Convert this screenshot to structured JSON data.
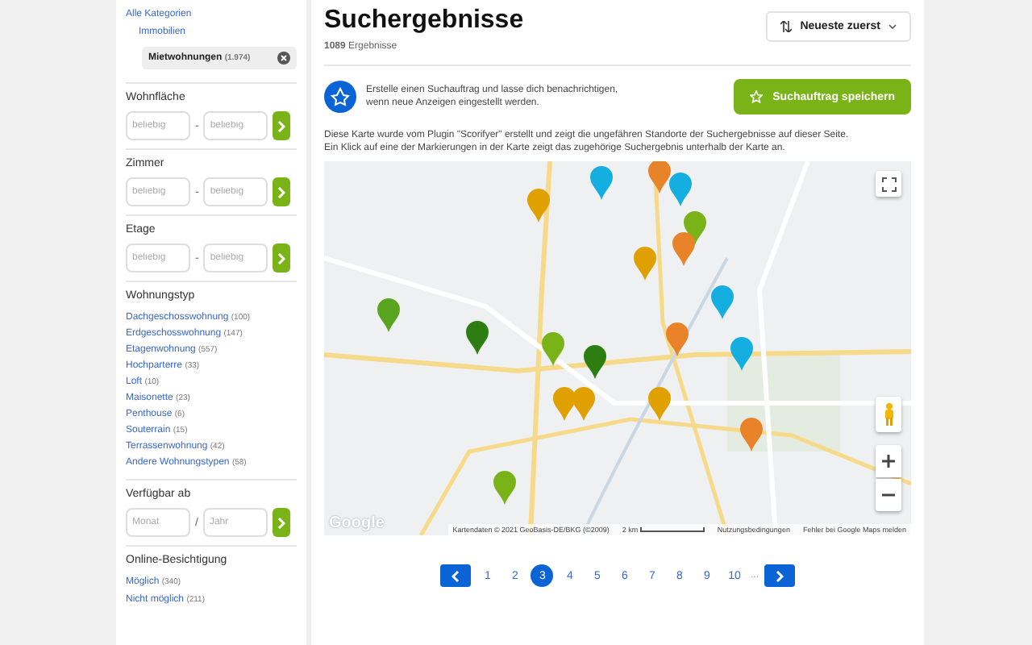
{
  "sidebar": {
    "categories": [
      {
        "label": "Alle Kategorien",
        "kind": "link"
      },
      {
        "label": "Immobilien",
        "kind": "link"
      },
      {
        "label": "Mietwohnungen",
        "count": "(1.974)",
        "kind": "chip"
      }
    ],
    "ranges": [
      {
        "title": "Wohnfläche",
        "from_placeholder": "beliebig",
        "to_placeholder": "beliebig",
        "separator": "-"
      },
      {
        "title": "Zimmer",
        "from_placeholder": "beliebig",
        "to_placeholder": "beliebig",
        "separator": "-"
      },
      {
        "title": "Etage",
        "from_placeholder": "beliebig",
        "to_placeholder": "beliebig",
        "separator": "-"
      }
    ],
    "types": {
      "title": "Wohnungstyp",
      "items": [
        {
          "label": "Dachgeschosswohnung",
          "count": "(100)"
        },
        {
          "label": "Erdgeschosswohnung",
          "count": "(147)"
        },
        {
          "label": "Etagenwohnung",
          "count": "(557)"
        },
        {
          "label": "Hochparterre",
          "count": "(33)"
        },
        {
          "label": "Loft",
          "count": "(10)"
        },
        {
          "label": "Maisonette",
          "count": "(23)"
        },
        {
          "label": "Penthouse",
          "count": "(6)"
        },
        {
          "label": "Souterrain",
          "count": "(15)"
        },
        {
          "label": "Terrassenwohnung",
          "count": "(42)"
        },
        {
          "label": "Andere Wohnungstypen",
          "count": "(58)"
        }
      ]
    },
    "available": {
      "title": "Verfügbar ab",
      "from_placeholder": "Monat",
      "to_placeholder": "Jahr",
      "separator": "/"
    },
    "viewing": {
      "title": "Online-Besichtigung",
      "items": [
        {
          "label": "Möglich",
          "count": "(340)"
        },
        {
          "label": "Nicht möglich",
          "count": "(211)"
        }
      ]
    }
  },
  "main": {
    "title": "Suchergebnisse",
    "count": "1089",
    "count_label": "Ergebnisse",
    "sort": "Neueste zuerst",
    "notice": {
      "lines": [
        "Erstelle einen Suchauftrag und lasse dich benachrichtigen,",
        "wenn neue Anzeigen eingestellt werden."
      ],
      "button": "Suchauftrag speichern"
    },
    "info": [
      "Diese Karte wurde vom Plugin \"Scorifyer\" erstellt und zeigt die ungefähren Standorte der Suchergebnisse auf dieser Seite.",
      "Ein Klick auf eine der Markierungen in der Karte zeigt das zugehörige Suchergebnis unterhalb der Karte an."
    ],
    "map": {
      "logo": "Google",
      "attribution": "Kartendaten © 2021 GeoBasis-DE/BKG (©2009)",
      "scale": "2 km",
      "terms": "Nutzungsbedingungen",
      "report": "Fehler bei Google Maps melden"
    },
    "pagination": {
      "pages": [
        {
          "label": "1",
          "selected": false
        },
        {
          "label": "2",
          "selected": false
        },
        {
          "label": "3",
          "selected": true
        },
        {
          "label": "4",
          "selected": false
        },
        {
          "label": "5",
          "selected": false
        },
        {
          "label": "6",
          "selected": false
        },
        {
          "label": "7",
          "selected": false
        },
        {
          "label": "8",
          "selected": false
        },
        {
          "label": "9",
          "selected": false
        },
        {
          "label": "10",
          "selected": false
        }
      ],
      "ellipsis": "..."
    }
  }
}
